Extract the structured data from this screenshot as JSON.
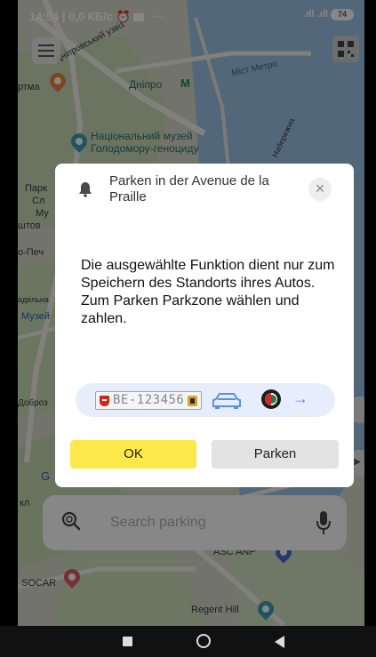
{
  "status_bar": {
    "time_speed": "14:54 | 0,0 КБ/с",
    "extra": "···",
    "signal": ".ıll .ıll",
    "battery": "74"
  },
  "map": {
    "labels": {
      "street_uzviz": "Дніпровський узвіз",
      "area_tma": "ртма",
      "metro_station": "Дніпро",
      "metro_bridge": "Міст Метро",
      "museum": "Національний музей Голодомору-геноциду",
      "naberezhna": "Набережна",
      "park": "Парк",
      "sl": "Сл",
      "my": "Му",
      "shtov": "штов",
      "pech": "о-Печ",
      "dalna": "адельна",
      "muzei": "Музей",
      "dobrov": "Доброз",
      "kl": "кл",
      "g": "G",
      "asc": "ASC ANP",
      "socar": "SOCAR",
      "regent": "Regent Hill",
      "dniprovsky": "Дніпровський"
    }
  },
  "search": {
    "placeholder": "Search parking"
  },
  "dialog": {
    "title": "Parken in der Avenue de la Praille",
    "body": "Die ausgewählte Funktion dient nur zum Speichern des Standorts ihres Autos. Zum Parken Parkzone wählen und zahlen.",
    "plate": "BE-123456",
    "arrow": "→",
    "close": "×",
    "ok_label": "OK",
    "park_label": "Parken"
  },
  "colors": {
    "ok_button": "#fde84a",
    "plate_row_bg": "#e6eefb",
    "accent_blue": "#5a8fe6",
    "metro_green": "#1d8a3d"
  }
}
